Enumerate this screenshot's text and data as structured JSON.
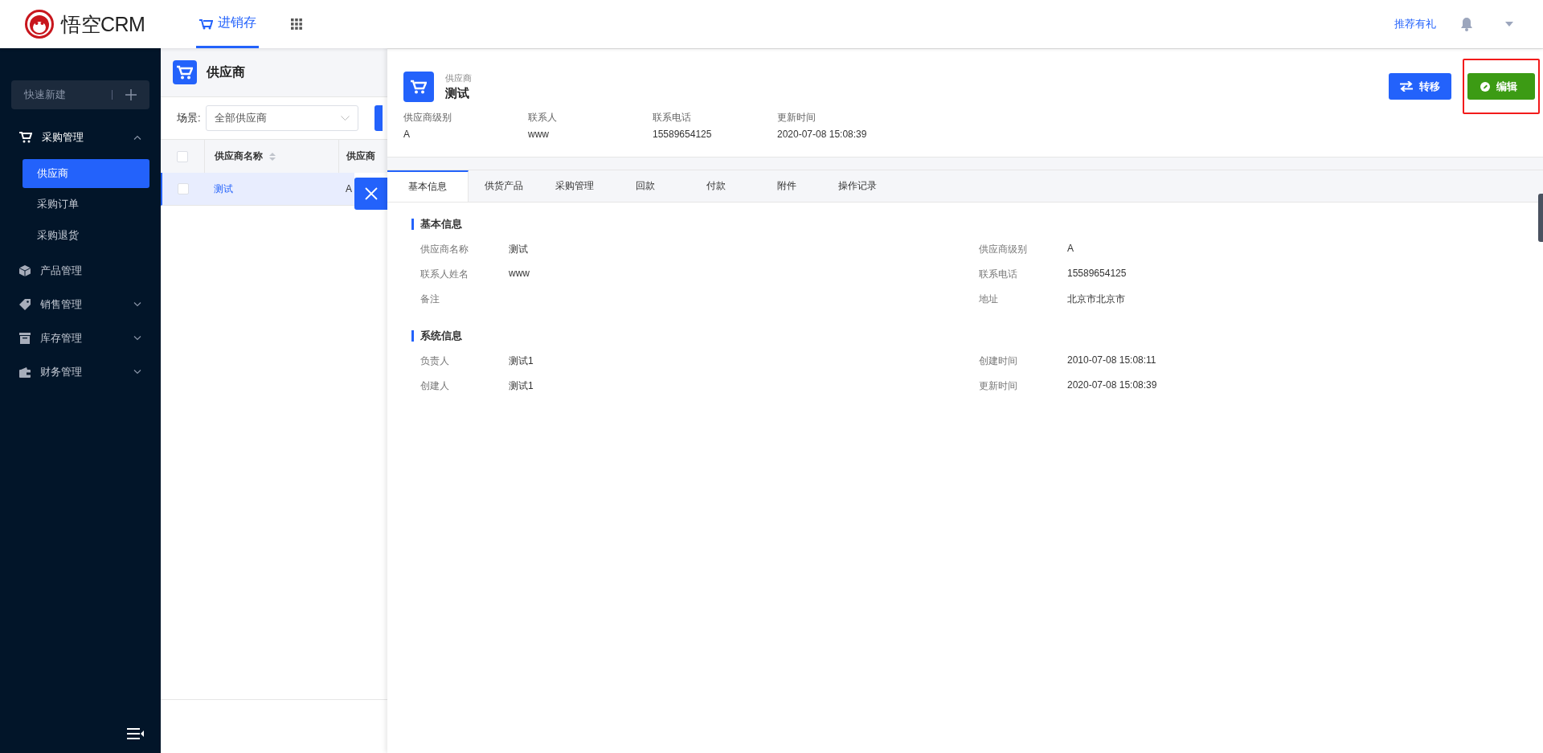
{
  "header": {
    "brand": "悟空CRM",
    "nav": [
      {
        "label": "进销存",
        "selected": true
      }
    ],
    "referral_link": "推荐有礼"
  },
  "sidebar": {
    "quick_create": "快速新建",
    "items": [
      {
        "label": "采购管理",
        "expandable": true,
        "expanded": true,
        "children": [
          {
            "label": "供应商",
            "selected": true
          },
          {
            "label": "采购订单",
            "selected": false
          },
          {
            "label": "采购退货",
            "selected": false
          }
        ]
      },
      {
        "label": "产品管理",
        "expandable": false,
        "expanded": false
      },
      {
        "label": "销售管理",
        "expandable": true,
        "expanded": false
      },
      {
        "label": "库存管理",
        "expandable": true,
        "expanded": false
      },
      {
        "label": "财务管理",
        "expandable": true,
        "expanded": false
      }
    ]
  },
  "list": {
    "title": "供应商",
    "scene_label": "场景:",
    "scene_value": "全部供应商",
    "select_all_checked": false,
    "columns": [
      "供应商名称",
      "供应商"
    ],
    "rows": [
      {
        "selected": true,
        "checked": false,
        "cells": [
          "测试",
          "A"
        ]
      }
    ]
  },
  "detail": {
    "type_label": "供应商",
    "name": "测试",
    "buttons": [
      {
        "label": "转移",
        "kind": "transfer",
        "highlighted": false
      },
      {
        "label": "编辑",
        "kind": "edit",
        "highlighted": true
      }
    ],
    "summary": [
      {
        "label": "供应商级别",
        "value": "A"
      },
      {
        "label": "联系人",
        "value": "www"
      },
      {
        "label": "联系电话",
        "value": "15589654125"
      },
      {
        "label": "更新时间",
        "value": "2020-07-08 15:08:39"
      }
    ],
    "tabs": [
      {
        "label": "基本信息",
        "selected": true
      },
      {
        "label": "供货产品",
        "selected": false
      },
      {
        "label": "采购管理",
        "selected": false
      },
      {
        "label": "回款",
        "selected": false
      },
      {
        "label": "付款",
        "selected": false
      },
      {
        "label": "附件",
        "selected": false
      },
      {
        "label": "操作记录",
        "selected": false
      }
    ],
    "sections": [
      {
        "title": "基本信息",
        "fields": [
          {
            "label": "供应商名称",
            "value": "测试"
          },
          {
            "label": "供应商级别",
            "value": "A"
          },
          {
            "label": "联系人姓名",
            "value": "www"
          },
          {
            "label": "联系电话",
            "value": "15589654125"
          },
          {
            "label": "备注"
          },
          {
            "label": "地址",
            "value": "北京市北京市"
          }
        ]
      },
      {
        "title": "系统信息",
        "fields": [
          {
            "label": "负责人",
            "value": "测试1"
          },
          {
            "label": "创建时间",
            "value": "2010-07-08 15:08:11"
          },
          {
            "label": "创建人",
            "value": "测试1"
          },
          {
            "label": "更新时间",
            "value": "2020-07-08 15:08:39"
          }
        ]
      }
    ]
  }
}
